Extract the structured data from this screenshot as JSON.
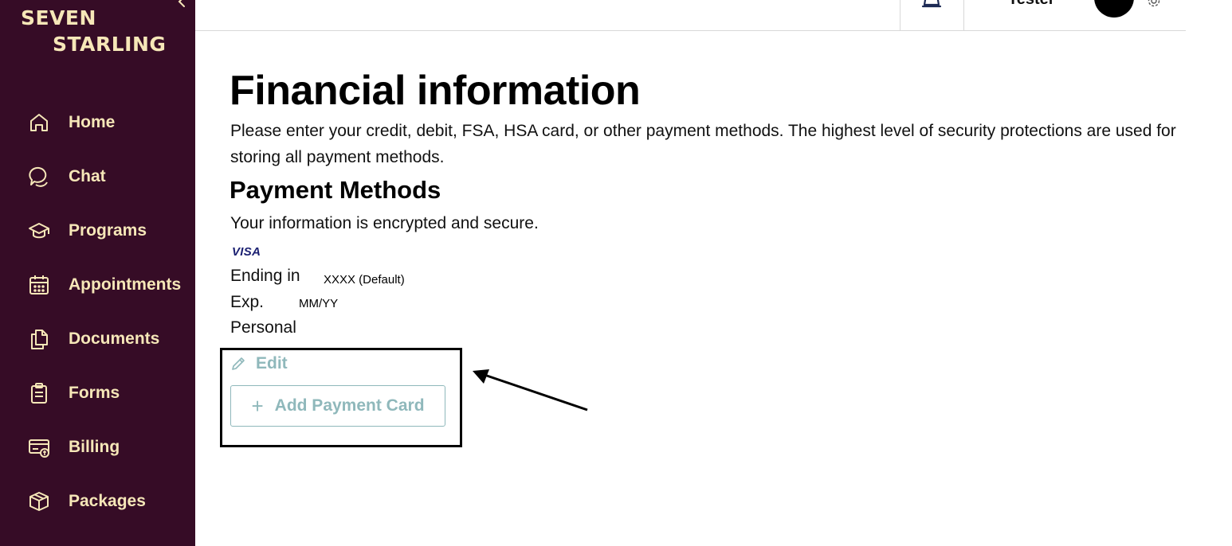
{
  "app": {
    "logo_line1": "SEVEN",
    "logo_line2": "STARLING",
    "brand_color": "#360c26",
    "brand_text_color": "#f6e7b8",
    "accent_color": "#8fb8bb"
  },
  "sidebar": {
    "items": [
      {
        "label": "Home",
        "icon": "home-icon"
      },
      {
        "label": "Chat",
        "icon": "chat-icon"
      },
      {
        "label": "Programs",
        "icon": "graduation-cap-icon"
      },
      {
        "label": "Appointments",
        "icon": "calendar-icon"
      },
      {
        "label": "Documents",
        "icon": "documents-icon"
      },
      {
        "label": "Forms",
        "icon": "clipboard-icon"
      },
      {
        "label": "Billing",
        "icon": "billing-icon"
      },
      {
        "label": "Packages",
        "icon": "package-icon"
      }
    ]
  },
  "header": {
    "user_name": "Tester"
  },
  "main": {
    "title": "Financial information",
    "intro": "Please enter your credit, debit, FSA, HSA card, or other payment methods. The highest level of security protections are used for storing all payment methods.",
    "section_title": "Payment Methods",
    "secure_text": "Your information is encrypted and secure.",
    "card": {
      "brand": "VISA",
      "ending_label": "Ending in",
      "ending_value": "XXXX (Default)",
      "exp_label": "Exp.",
      "exp_value": "MM/YY",
      "type": "Personal"
    },
    "edit_label": "Edit",
    "add_card_label": "Add Payment Card"
  }
}
